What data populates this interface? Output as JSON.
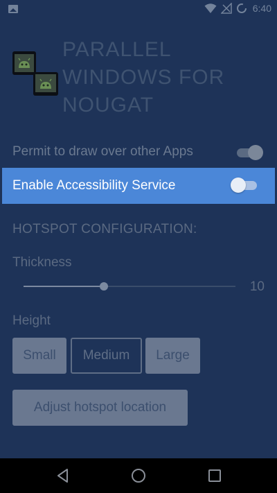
{
  "status_bar": {
    "time": "6:40",
    "icons": [
      "image-notification-icon",
      "wifi-icon",
      "signal-icon",
      "battery-icon"
    ]
  },
  "app": {
    "title": "PARALLEL WINDOWS FOR NOUGAT",
    "logo_icon": "app-logo-icon"
  },
  "settings": {
    "permit_overlay": {
      "label": "Permit to draw over other Apps",
      "enabled": true
    },
    "accessibility": {
      "label": "Enable Accessibility Service",
      "enabled": false
    }
  },
  "hotspot": {
    "section_title": "HOTSPOT CONFIGURATION:",
    "thickness": {
      "label": "Thickness",
      "value": "10",
      "slider_fraction": 0.38
    },
    "height": {
      "label": "Height",
      "options": [
        "Small",
        "Medium",
        "Large"
      ],
      "selected": "Medium"
    },
    "adjust_button": "Adjust hotspot location"
  },
  "colors": {
    "background": "#1e3358",
    "highlight": "#4b87d8"
  },
  "nav_bar": {
    "icons": [
      "back-icon",
      "home-icon",
      "recents-icon"
    ]
  }
}
